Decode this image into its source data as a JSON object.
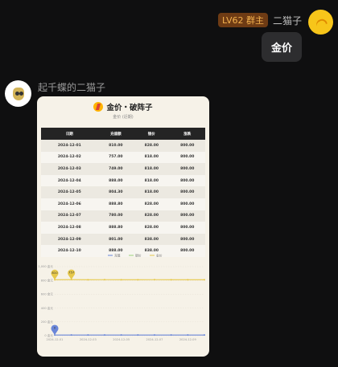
{
  "user_right": {
    "level": "LV62",
    "role": "群主",
    "name": "二猫子",
    "message": "金价"
  },
  "user_left": {
    "name": "起千蝶的二猫子"
  },
  "card": {
    "title": "金价・破阵子",
    "subtitle": "金价 (近期)",
    "table": {
      "headers": [
        "日期",
        "充值额",
        "银价",
        "涨跌"
      ],
      "rows": [
        [
          "2024-12-01",
          "810.00",
          "828.00",
          "800.00"
        ],
        [
          "2024-12-02",
          "757.00",
          "818.00",
          "800.00"
        ],
        [
          "2024-12-03",
          "749.00",
          "818.00",
          "800.00"
        ],
        [
          "2024-12-04",
          "888.00",
          "818.00",
          "800.00"
        ],
        [
          "2024-12-05",
          "804.30",
          "818.00",
          "800.00"
        ],
        [
          "2024-12-06",
          "888.80",
          "828.00",
          "800.00"
        ],
        [
          "2024-12-07",
          "780.00",
          "828.00",
          "800.00"
        ],
        [
          "2024-12-08",
          "888.80",
          "828.00",
          "800.00"
        ],
        [
          "2024-12-09",
          "801.00",
          "838.00",
          "800.00"
        ],
        [
          "2024-12-10",
          "888.00",
          "838.00",
          "800.00"
        ]
      ]
    }
  },
  "chart_data": {
    "type": "line",
    "legend": [
      "充值",
      "银价",
      "金价"
    ],
    "y_ticks": [
      "1,000 金元",
      "800 金元",
      "600 金元",
      "400 金元",
      "200 金元",
      "0 金元"
    ],
    "x_ticks": [
      "2024-12-01",
      "2024-12-03",
      "2024-12-05",
      "2024-12-07",
      "2024-12-09"
    ],
    "series": [
      {
        "name": "金价",
        "color": "#e6c84a",
        "values": [
          810,
          812,
          810,
          811,
          810,
          810,
          811,
          810,
          810,
          810
        ]
      },
      {
        "name": "充值",
        "color": "#6a86d8",
        "values": [
          10,
          10,
          10,
          10,
          10,
          10,
          10,
          10,
          10,
          10
        ]
      }
    ],
    "ylim": [
      0,
      1000
    ],
    "markers": [
      {
        "label": "810",
        "series": "金价",
        "index": 0
      },
      {
        "label": "757",
        "series": "金价",
        "index": 1
      },
      {
        "label": "0",
        "series": "充值",
        "index": 0
      }
    ]
  },
  "colors": {
    "badge_bg": "#6e3b14",
    "badge_text": "#f3b24e"
  }
}
